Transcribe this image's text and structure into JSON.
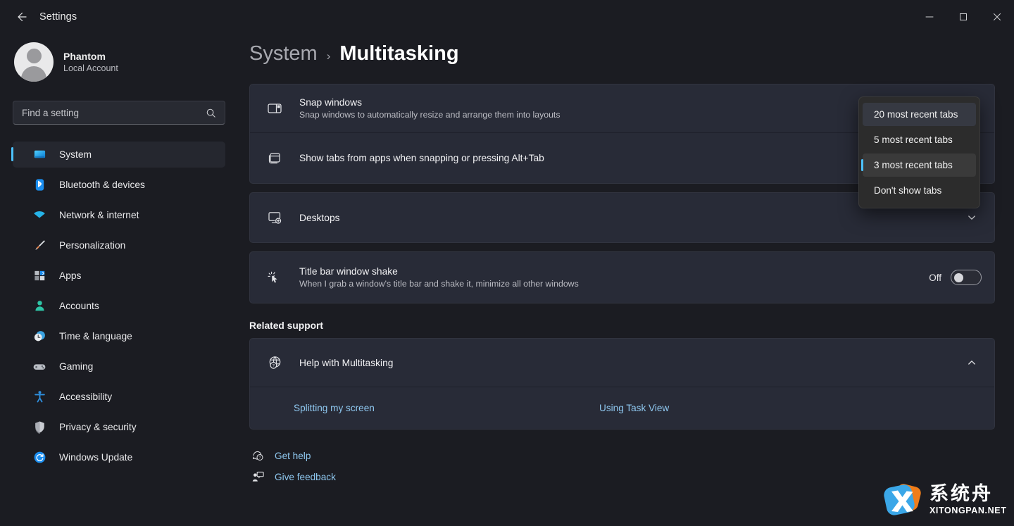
{
  "window": {
    "title": "Settings",
    "back_icon": "arrow-left-icon",
    "controls": {
      "minimize": "minimize-icon",
      "maximize": "maximize-icon",
      "close": "close-icon"
    }
  },
  "sidebar": {
    "account": {
      "name": "Phantom",
      "type": "Local Account",
      "avatar_icon": "user-avatar-icon"
    },
    "search": {
      "placeholder": "Find a setting",
      "value": "",
      "icon": "search-icon"
    },
    "items": [
      {
        "label": "System",
        "icon": "system-monitor-icon",
        "selected": true
      },
      {
        "label": "Bluetooth & devices",
        "icon": "bluetooth-icon",
        "selected": false
      },
      {
        "label": "Network & internet",
        "icon": "wifi-icon",
        "selected": false
      },
      {
        "label": "Personalization",
        "icon": "paintbrush-icon",
        "selected": false
      },
      {
        "label": "Apps",
        "icon": "apps-grid-icon",
        "selected": false
      },
      {
        "label": "Accounts",
        "icon": "account-person-icon",
        "selected": false
      },
      {
        "label": "Time & language",
        "icon": "clock-globe-icon",
        "selected": false
      },
      {
        "label": "Gaming",
        "icon": "gamepad-icon",
        "selected": false
      },
      {
        "label": "Accessibility",
        "icon": "accessibility-icon",
        "selected": false
      },
      {
        "label": "Privacy & security",
        "icon": "shield-icon",
        "selected": false
      },
      {
        "label": "Windows Update",
        "icon": "update-refresh-icon",
        "selected": false
      }
    ]
  },
  "breadcrumb": {
    "parent": "System",
    "separator": "›",
    "current": "Multitasking"
  },
  "settings_rows": [
    {
      "title": "Snap windows",
      "subtitle": "Snap windows to automatically resize and arrange them into layouts",
      "icon": "snap-layout-icon"
    },
    {
      "title": "Show tabs from apps when snapping or pressing Alt+Tab",
      "subtitle": "",
      "icon": "tabs-window-icon"
    },
    {
      "title": "Desktops",
      "subtitle": "",
      "icon": "add-desktop-icon",
      "chevron": "chevron-down-icon"
    },
    {
      "title": "Title bar window shake",
      "subtitle": "When I grab a window's title bar and shake it, minimize all other windows",
      "icon": "shake-cursor-icon",
      "toggle": {
        "label": "Off",
        "on": false
      }
    }
  ],
  "dropdown": {
    "options": [
      {
        "label": "20 most recent tabs",
        "state": "hover"
      },
      {
        "label": "5 most recent tabs",
        "state": "normal"
      },
      {
        "label": "3 most recent tabs",
        "state": "selected"
      },
      {
        "label": "Don't show tabs",
        "state": "normal"
      }
    ]
  },
  "related_support": {
    "heading": "Related support",
    "help_row": {
      "title": "Help with Multitasking",
      "icon": "globe-help-icon",
      "chevron": "chevron-up-icon"
    },
    "links": [
      "Splitting my screen",
      "Using Task View"
    ]
  },
  "footer": [
    {
      "label": "Get help",
      "icon": "get-help-icon"
    },
    {
      "label": "Give feedback",
      "icon": "give-feedback-icon"
    }
  ],
  "watermark": {
    "cn": "系统舟",
    "en": "XITONGPAN.NET"
  },
  "colors": {
    "accent": "#4cc2ff",
    "link": "#8fc8f0",
    "page_bg": "#1b1c22",
    "card_bg": "#282b37",
    "flyout_bg": "#2c2c2c"
  }
}
